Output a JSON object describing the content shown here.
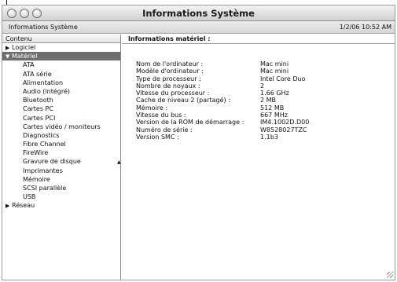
{
  "window": {
    "title": "Informations Système"
  },
  "infobar": {
    "left_text": "Informations Système",
    "right_text": "1/2/06 10:52 AM"
  },
  "sidebar": {
    "header": "Contenu",
    "items": [
      {
        "label": "Logiciel",
        "level": "top",
        "disclosure": "▶"
      },
      {
        "label": "Matériel",
        "level": "top",
        "disclosure": "▼",
        "selected": true
      },
      {
        "label": "ATA",
        "level": "child"
      },
      {
        "label": "ATA série",
        "level": "child"
      },
      {
        "label": "Alimentation",
        "level": "child"
      },
      {
        "label": "Audio (intégré)",
        "level": "child"
      },
      {
        "label": "Bluetooth",
        "level": "child"
      },
      {
        "label": "Cartes PC",
        "level": "child"
      },
      {
        "label": "Cartes PCI",
        "level": "child"
      },
      {
        "label": "Cartes vidéo / moniteurs",
        "level": "child"
      },
      {
        "label": "Diagnostics",
        "level": "child"
      },
      {
        "label": "Fibre Channel",
        "level": "child"
      },
      {
        "label": "FireWire",
        "level": "child"
      },
      {
        "label": "Gravure de disque",
        "level": "child"
      },
      {
        "label": "Imprimantes",
        "level": "child"
      },
      {
        "label": "Mémoire",
        "level": "child"
      },
      {
        "label": "SCSI parallèle",
        "level": "child"
      },
      {
        "label": "USB",
        "level": "child"
      },
      {
        "label": "Réseau",
        "level": "top",
        "disclosure": "▶"
      }
    ]
  },
  "main": {
    "title": "Informations matériel :",
    "specs": [
      {
        "label": "Nom de l'ordinateur :",
        "value": "Mac mini"
      },
      {
        "label": "Modèle d'ordinateur :",
        "value": "Mac mini"
      },
      {
        "label": "Type de processeur :",
        "value": "Intel Core Duo"
      },
      {
        "label": "Nombre de noyaux :",
        "value": "2"
      },
      {
        "label": "Vitesse du processeur :",
        "value": "1.66 GHz"
      },
      {
        "label": "Cache de niveau 2 (partagé) :",
        "value": "2 MB"
      },
      {
        "label": "Mémoire :",
        "value": "512 MB"
      },
      {
        "label": "Vitesse du bus :",
        "value": "667 MHz"
      },
      {
        "label": "Version de la ROM de démarrage :",
        "value": "IM4.1002D.D00"
      },
      {
        "label": "Numéro de série :",
        "value": "W8528027TZC"
      },
      {
        "label": "Version SMC :",
        "value": "1.1b3"
      }
    ]
  },
  "icons": {
    "close": "close-icon",
    "minimize": "minimize-icon",
    "zoom": "zoom-icon",
    "disclosure_collapsed": "disclosure-triangle-right-icon",
    "disclosure_expanded": "disclosure-triangle-down-icon"
  }
}
